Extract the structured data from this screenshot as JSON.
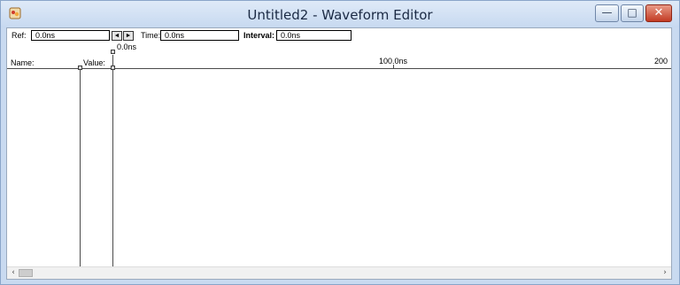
{
  "window": {
    "title": "Untitled2 - Waveform Editor",
    "controls": {
      "minimize": "—",
      "maximize": "□",
      "close": "✕"
    }
  },
  "toolbar": {
    "ref_label": "Ref:",
    "ref_value": "0.0ns",
    "prev_button": "◄",
    "next_button": "►",
    "time_label": "Time:",
    "time_value": "0.0ns",
    "interval_label": "Interval:",
    "interval_value": "0.0ns"
  },
  "columns": {
    "name": "Name:",
    "value": "Value:"
  },
  "timeline": {
    "cursor_time": "0.0ns",
    "ticks": [
      "100.0ns",
      "200"
    ]
  },
  "scrollbar": {
    "left_arrow": "‹",
    "right_arrow": "›"
  }
}
